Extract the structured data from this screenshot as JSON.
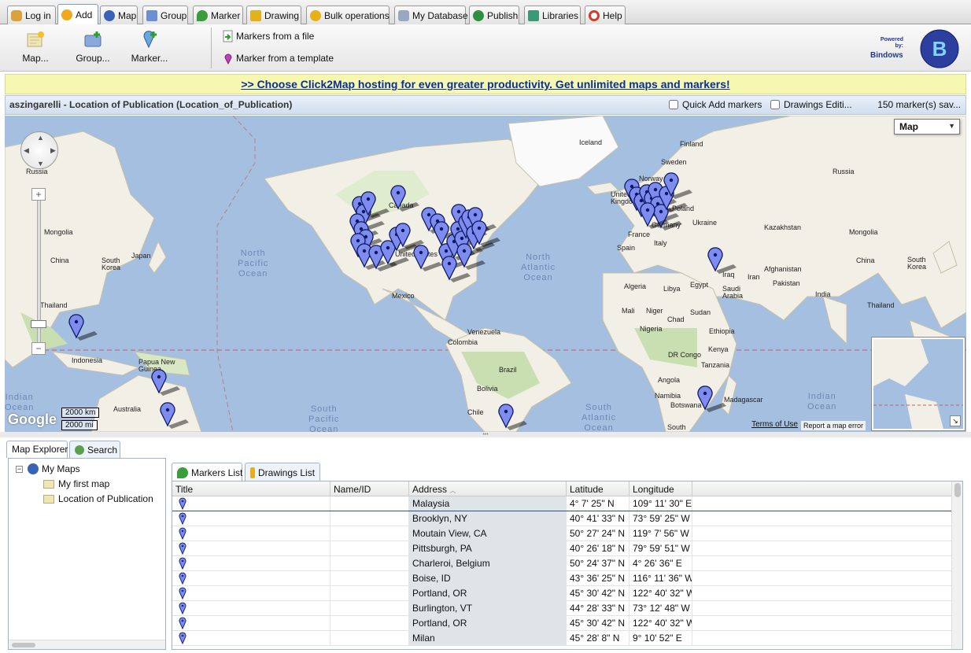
{
  "tabs": [
    {
      "label": "Log in",
      "icon": "key-icon",
      "color": "#d9a23b"
    },
    {
      "label": "Add",
      "icon": "sun-add-icon",
      "color": "#f0a81c",
      "active": true
    },
    {
      "label": "Map",
      "icon": "globe-icon",
      "color": "#3b63b3"
    },
    {
      "label": "Group",
      "icon": "folder-icon",
      "color": "#6b8fd0"
    },
    {
      "label": "Marker",
      "icon": "marker-icon",
      "color": "#3a9c3a"
    },
    {
      "label": "Drawing",
      "icon": "pencil-icon",
      "color": "#e2b21d"
    },
    {
      "label": "Bulk operations",
      "icon": "gear-icon",
      "color": "#e7b01b"
    },
    {
      "label": "My Database",
      "icon": "database-icon",
      "color": "#9aa7c0"
    },
    {
      "label": "Publish",
      "icon": "publish-globe-icon",
      "color": "#2f8f3e"
    },
    {
      "label": "Libraries",
      "icon": "books-icon",
      "color": "#3a9a78"
    },
    {
      "label": "Help",
      "icon": "lifebuoy-icon",
      "color": "#d43b2c"
    }
  ],
  "toolbar": {
    "map_label": "Map...",
    "group_label": "Group...",
    "marker_label": "Marker...",
    "from_file_label": "Markers from a file",
    "from_template_label": "Marker from a template"
  },
  "logo": {
    "powered": "Powered by:",
    "name": "Bindows"
  },
  "promo": {
    "text": ">> Choose Click2Map hosting for even greater productivity. Get unlimited maps and markers!"
  },
  "map_header": {
    "title": "aszingarelli - Location of Publication (Location_of_Publication)",
    "quick_add": "Quick Add markers",
    "drawings": "Drawings Editi...",
    "saved": "150 marker(s) sav..."
  },
  "map": {
    "type_select": "Map",
    "scale_km": "2000 km",
    "scale_mi": "2000 mi",
    "google": "Google",
    "terms": "Terms of Use",
    "report": "Report a map error",
    "zoom_in": "+",
    "zoom_out": "−",
    "labels": {
      "russia_w": "Russia",
      "mongolia_w": "Mongolia",
      "china_w": "China",
      "south_korea_w": "South Korea",
      "japan": "Japan",
      "thailand": "Thailand",
      "indonesia": "Indonesia",
      "papua": "Papua New Guinea",
      "australia": "Australia",
      "canada": "Canada",
      "united_states": "United States",
      "mexico": "Mexico",
      "venezuela": "Venezuela",
      "colombia": "Colombia",
      "brazil": "Brazil",
      "bolivia": "Bolivia",
      "chile": "Chile",
      "iceland": "Iceland",
      "finland": "Finland",
      "sweden": "Sweden",
      "norway": "Norway",
      "united_kingdom": "United Kingdom",
      "poland": "Poland",
      "germany": "Germany",
      "france": "France",
      "spain": "Spain",
      "italy": "Italy",
      "ukraine": "Ukraine",
      "russia_e": "Russia",
      "kazakhstan": "Kazakhstan",
      "mongolia_e": "Mongolia",
      "china_e": "China",
      "south_korea_e": "South Korea",
      "afghanistan": "Afghanistan",
      "pakistan": "Pakistan",
      "iraq": "Iraq",
      "iran": "Iran",
      "saudi_arabia": "Saudi Arabia",
      "india": "India",
      "thailand_e": "Thailand",
      "algeria": "Algeria",
      "libya": "Libya",
      "egypt": "Egypt",
      "mali": "Mali",
      "niger": "Niger",
      "chad": "Chad",
      "sudan": "Sudan",
      "nigeria": "Nigeria",
      "ethiopia": "Ethiopia",
      "dr_congo": "DR Congo",
      "kenya": "Kenya",
      "tanzania": "Tanzania",
      "angola": "Angola",
      "namibia": "Namibia",
      "botswana": "Botswana",
      "madagascar": "Madagascar",
      "south_africa": "South"
    },
    "oceans": {
      "north_pacific": "North\nPacific\nOcean",
      "north_atlantic": "North\nAtlantic\nOcean",
      "south_pacific": "South\nPacific\nOcean",
      "south_atlantic": "South\nAtlantic\nOcean",
      "indian_w": "Indian\nOcean",
      "indian_e": "Indian\nOcean"
    }
  },
  "explorer": {
    "tab_map_explorer": "Map Explorer",
    "tab_search": "Search",
    "root": "My Maps",
    "maps": [
      "My first map",
      "Location of Publication"
    ]
  },
  "grid_tabs": {
    "markers": "Markers List",
    "drawings": "Drawings List"
  },
  "grid": {
    "columns": [
      "Title",
      "Name/ID",
      "Address",
      "Latitude",
      "Longitude"
    ],
    "rows": [
      {
        "address": "Malaysia",
        "lat": "4° 7' 25\" N",
        "lng": "109° 11' 30\" E"
      },
      {
        "address": "Brooklyn, NY",
        "lat": "40° 41' 33\" N",
        "lng": "73° 59' 25\" W"
      },
      {
        "address": "Moutain View, CA",
        "lat": "50° 27' 24\" N",
        "lng": "119° 7' 56\" W"
      },
      {
        "address": "Pittsburgh, PA",
        "lat": "40° 26' 18\" N",
        "lng": "79° 59' 51\" W"
      },
      {
        "address": "Charleroi, Belgium",
        "lat": "50° 24' 37\" N",
        "lng": "4° 26' 36\" E"
      },
      {
        "address": "Boise, ID",
        "lat": "43° 36' 25\" N",
        "lng": "116° 11' 36\" W"
      },
      {
        "address": "Portland, OR",
        "lat": "45° 30' 42\" N",
        "lng": "122° 40' 32\" W"
      },
      {
        "address": "Burlington, VT",
        "lat": "44° 28' 33\" N",
        "lng": "73° 12' 48\" W"
      },
      {
        "address": "Portland, OR",
        "lat": "45° 30' 42\" N",
        "lng": "122° 40' 32\" W"
      },
      {
        "address": "Milan",
        "lat": "45° 28' 8\" N",
        "lng": "9° 10' 52\" E"
      }
    ]
  },
  "colors": {
    "marker": "#7e8cf0",
    "land": "#f2efe6",
    "water": "#a4bfe0",
    "promo_link": "#0b2e99"
  }
}
